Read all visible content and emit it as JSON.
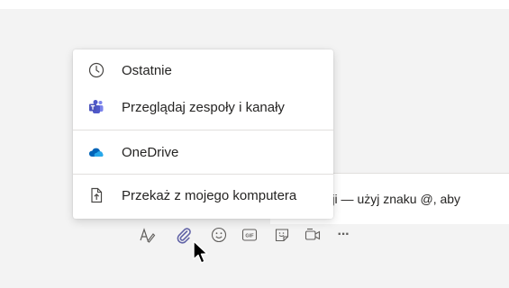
{
  "attach_menu": {
    "items": [
      {
        "label": "Ostatnie",
        "icon": "clock-icon"
      },
      {
        "label": "Przeglądaj zespoły i kanały",
        "icon": "teams-icon"
      },
      {
        "label": "OneDrive",
        "icon": "onedrive-cloud-icon"
      },
      {
        "label": "Przekaż z mojego komputera",
        "icon": "upload-file-icon"
      }
    ]
  },
  "compose": {
    "text": "rsacji — użyj znaku @, aby"
  },
  "toolbar": {
    "buttons": [
      "format-icon",
      "attach-icon",
      "emoji-icon",
      "gif-icon",
      "sticker-icon",
      "meet-now-icon",
      "more-icon"
    ],
    "gif_label": "GIF",
    "more_label": "···",
    "active_color": "#6264a7"
  },
  "colors": {
    "accent": "#6264a7",
    "onedrive_blue": "#0364b8",
    "background": "#f3f3f3"
  }
}
